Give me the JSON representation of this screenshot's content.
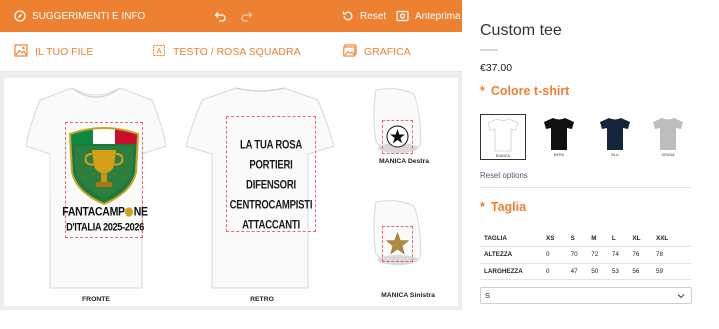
{
  "topbar": {
    "help_label": "SUGGERIMENTI E INFO",
    "reset_label": "Reset",
    "preview_label": "Anteprima",
    "color": "#ee8131"
  },
  "toolbar": {
    "file_label": "IL TUO FILE",
    "text_label": "TESTO / ROSA SQUADRA",
    "graphic_label": "GRAFICA"
  },
  "canvas": {
    "front": {
      "label": "FRONTE",
      "design_line1": "FANTACAMP",
      "design_line1_end": "NE",
      "design_line2": "D'ITALIA 2025-2026",
      "design_image": "trophy-shield-logo"
    },
    "back": {
      "label": "RETRO",
      "lines": [
        "LA TUA ROSA",
        "PORTIERI",
        "DIFENSORI",
        "CENTROCAMPISTI",
        "ATTACCANTI"
      ]
    },
    "sleeve_right": {
      "label": "MANICA Destra",
      "design_image": "champions-ball-icon"
    },
    "sleeve_left": {
      "label": "MANICA Sinistra",
      "design_image": "gold-star-icon"
    }
  },
  "product": {
    "title": "Custom tee",
    "price": "€37.00",
    "color_heading": "Colore t-shirt",
    "colors": [
      {
        "name": "BIANCA",
        "hex": "#ffffff",
        "selected": true
      },
      {
        "name": "NERA",
        "hex": "#111111",
        "selected": false
      },
      {
        "name": "BLU",
        "hex": "#14243b",
        "selected": false
      },
      {
        "name": "GRIGIA",
        "hex": "#bdbdbd",
        "selected": false
      }
    ],
    "reset_options": "Reset options",
    "size_heading": "Taglia",
    "size_table": {
      "headers": [
        "TAGLIA",
        "XS",
        "S",
        "M",
        "L",
        "XL",
        "XXL"
      ],
      "rows": [
        [
          "ALTEZZA",
          "0",
          "70",
          "72",
          "74",
          "76",
          "78"
        ],
        [
          "LARGHEZZA",
          "0",
          "47",
          "50",
          "53",
          "56",
          "59"
        ]
      ]
    },
    "size_selected": "S",
    "accent": "#ee8131"
  }
}
